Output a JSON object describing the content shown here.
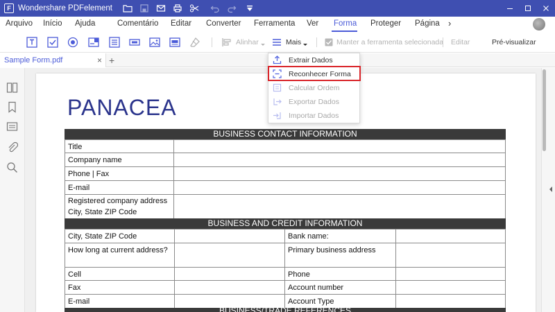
{
  "app": {
    "title": "Wondershare PDFelement"
  },
  "menu": {
    "items": [
      "Arquivo",
      "Início",
      "Ajuda",
      "Comentário",
      "Editar",
      "Converter",
      "Ferramenta",
      "Ver",
      "Forma",
      "Proteger",
      "Página"
    ],
    "active": "Forma",
    "more_glyph": "›"
  },
  "ribbon": {
    "align_label": "Alinhar",
    "more_label": "Mais",
    "keep_tool_label": "Manter a ferramenta selecionada",
    "edit_label": "Editar",
    "preview_label": "Pré-visualizar"
  },
  "tabs": {
    "doc_name": "Sample Form.pdf",
    "close_glyph": "×",
    "add_glyph": "+"
  },
  "dropdown": {
    "items": [
      {
        "label": "Extrair Dados",
        "enabled": true,
        "icon": "extract-data-icon"
      },
      {
        "label": "Reconhecer Forma",
        "enabled": true,
        "icon": "recognize-form-icon",
        "highlighted": true
      },
      {
        "label": "Calcular Ordem",
        "enabled": false,
        "icon": "calculate-order-icon"
      },
      {
        "label": "Exportar Dados",
        "enabled": false,
        "icon": "export-data-icon"
      },
      {
        "label": "Importar Dados",
        "enabled": false,
        "icon": "import-data-icon"
      }
    ]
  },
  "document": {
    "brand": "PANACEA",
    "sections": [
      {
        "title": "BUSINESS CONTACT INFORMATION",
        "rows": [
          "Title",
          "Company name",
          "Phone | Fax",
          "E-mail",
          "Registered company address\nCity, State ZIP Code"
        ]
      },
      {
        "title": "BUSINESS AND CREDIT INFORMATION",
        "rows": [
          {
            "left": "City, State ZIP Code",
            "right": "Bank name:"
          },
          {
            "left": "How long at current address?",
            "right": "Primary business address"
          },
          {
            "left": "Cell",
            "right": "Phone"
          },
          {
            "left": "Fax",
            "right": "Account number"
          },
          {
            "left": "E-mail",
            "right": "Account Type"
          }
        ]
      },
      {
        "title": "BUSINESS/TRADE REFERENCES"
      }
    ]
  },
  "colors": {
    "titlebar": "#3f4fb1",
    "accent": "#4b5bd8",
    "highlight": "#d9252a",
    "section_header": "#3a3a3a",
    "brand": "#2b348c"
  }
}
